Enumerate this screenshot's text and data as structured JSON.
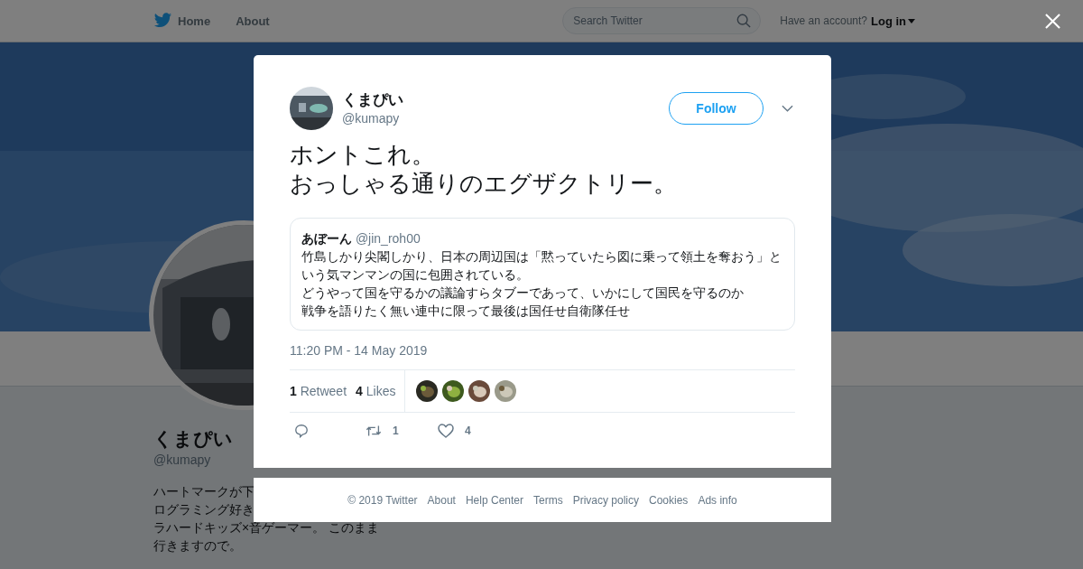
{
  "nav": {
    "items": [
      {
        "label": "Home"
      },
      {
        "label": "About"
      }
    ],
    "search": {
      "placeholder": "Search Twitter"
    },
    "account_prompt": "Have an account?",
    "login": "Log in"
  },
  "profile": {
    "name": "くまぴい",
    "handle": "@kumapy",
    "bio_lines": [
      "ハートマークが下",
      "ログラミング好き",
      "ラハードキッズ×音ゲーマー。 このまま",
      "行きますので。"
    ]
  },
  "tweet": {
    "author": {
      "name": "くまぴい",
      "handle": "@kumapy"
    },
    "follow": "Follow",
    "text_lines": [
      "ホントこれ。",
      "おっしゃる通りのエグザクトリー。"
    ],
    "quote": {
      "name": "あぼーん",
      "handle": "@jin_roh00",
      "paragraphs": [
        "竹島しかり尖閣しかり、日本の周辺国は「黙っていたら図に乗って領土を奪おう」という気マンマンの国に包囲されている。",
        "どうやって国を守るかの議論すらタブーであって、いかにして国民を守るのか",
        "戦争を語りたく無い連中に限って最後は国任せ自衛隊任せ"
      ]
    },
    "timestamp": "11:20 PM - 14 May 2019",
    "stats": [
      {
        "count": "1",
        "label": "Retweet"
      },
      {
        "count": "4",
        "label": "Likes"
      }
    ],
    "likers": [
      {
        "kind": "picture"
      },
      {
        "kind": "picture"
      },
      {
        "kind": "picture"
      },
      {
        "kind": "picture"
      }
    ],
    "actions": [
      {
        "kind": "reply"
      },
      {
        "kind": "retweet",
        "count": "1"
      },
      {
        "kind": "like",
        "count": "4"
      }
    ]
  },
  "footer": {
    "copyright": "© 2019 Twitter",
    "links": [
      "About",
      "Help Center",
      "Terms",
      "Privacy policy",
      "Cookies",
      "Ads info"
    ]
  }
}
